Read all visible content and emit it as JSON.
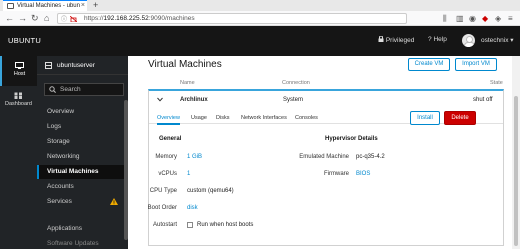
{
  "browser": {
    "tab_title": "Virtual Machines - ubun",
    "url_host": "192.168.225.52",
    "url_path": ":9090/machines",
    "url_prefix": "https://"
  },
  "masthead": {
    "brand": "UBUNTU",
    "privileged": "Privileged",
    "help": "Help",
    "user": "ostechnix"
  },
  "vnav": [
    {
      "label": "Host"
    },
    {
      "label": "Dashboard"
    }
  ],
  "sidebar": {
    "host": "ubuntuserver",
    "search_placeholder": "Search",
    "items": [
      "Overview",
      "Logs",
      "Storage",
      "Networking",
      "Virtual Machines",
      "Accounts",
      "Services",
      "",
      "Applications",
      "Software Updates"
    ]
  },
  "main": {
    "title": "Virtual Machines",
    "create_vm": "Create VM",
    "import_vm": "Import VM",
    "columns": [
      "Name",
      "Connection",
      "State"
    ],
    "vm": {
      "name": "Archlinux",
      "connection": "System",
      "state": "shut off"
    },
    "tabs": [
      "Overview",
      "Usage",
      "Disks",
      "Network Interfaces",
      "Consoles"
    ],
    "install": "Install",
    "delete": "Delete",
    "general": {
      "heading": "General",
      "memory_label": "Memory",
      "memory_value": "1 GiB",
      "vcpus_label": "vCPUs",
      "vcpus_value": "1",
      "cputype_label": "CPU Type",
      "cputype_value": "custom (qemu64)",
      "bootorder_label": "Boot Order",
      "bootorder_value": "disk",
      "autostart_label": "Autostart",
      "autostart_value": "Run when host boots"
    },
    "hypervisor": {
      "heading": "Hypervisor Details",
      "emulated_label": "Emulated Machine",
      "emulated_value": "pc-q35-4.2",
      "firmware_label": "Firmware",
      "firmware_value": "BIOS"
    }
  },
  "colors": {
    "accent": "#0088ce",
    "danger": "#cc0000",
    "masthead": "#151515",
    "sidebar": "#212427"
  }
}
